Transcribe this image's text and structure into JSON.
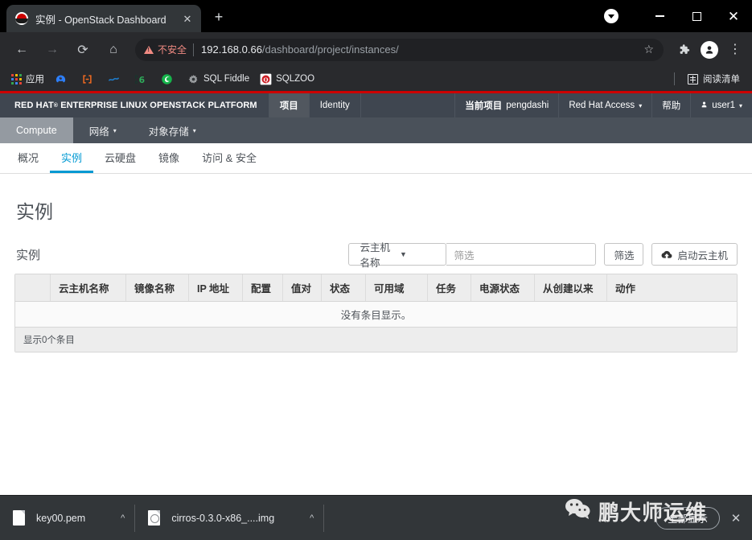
{
  "browser": {
    "tab": {
      "title": "实例 - OpenStack Dashboard",
      "favicon": "redhat-logo-icon",
      "close": "✕"
    },
    "new_tab": "+",
    "window_controls": {
      "tab_search": "tab-search-icon",
      "minimize": "minimize-icon",
      "maximize": "maximize-icon",
      "close": "✕"
    },
    "toolbar": {
      "back": "←",
      "forward": "→",
      "reload": "⟳",
      "home": "⌂",
      "security_label": "不安全",
      "url_host": "192.168.0.66",
      "url_path": "/dashboard/project/instances/",
      "bookmark_star": "☆",
      "extensions": "puzzle-piece-icon",
      "profile": "profile-avatar-icon",
      "menu": "⋮"
    },
    "bookmarks": [
      {
        "label": "应用",
        "icon": "apps-grid-icon"
      },
      {
        "label": "",
        "icon": "blue-controller-icon"
      },
      {
        "label": "",
        "icon": "orange-bracket-icon"
      },
      {
        "label": "",
        "icon": "blue-wave-icon"
      },
      {
        "label": "",
        "icon": "p6-green-icon"
      },
      {
        "label": "",
        "icon": "green-browser-icon"
      },
      {
        "label": "SQL Fiddle",
        "icon": "gray-gear-icon"
      },
      {
        "label": "SQLZOO",
        "icon": "red-badge-icon"
      }
    ],
    "reading_list": {
      "label": "阅读清单",
      "icon": "reading-list-icon"
    }
  },
  "openstack": {
    "brand": "RED HAT",
    "brand_sup": "®",
    "brand_rest": "ENTERPRISE LINUX OPENSTACK PLATFORM",
    "nav": [
      {
        "label": "项目",
        "active": true
      },
      {
        "label": "Identity",
        "active": false
      }
    ],
    "current_project_label": "当前项目",
    "current_project_name": "pengdashi",
    "redhat_access": "Red Hat Access",
    "help": "帮助",
    "user": "user1",
    "subnav": [
      {
        "label": "Compute",
        "active": true,
        "caret": false
      },
      {
        "label": "网络",
        "active": false,
        "caret": true
      },
      {
        "label": "对象存储",
        "active": false,
        "caret": true
      }
    ],
    "tabs": [
      {
        "label": "概况",
        "active": false
      },
      {
        "label": "实例",
        "active": true
      },
      {
        "label": "云硬盘",
        "active": false
      },
      {
        "label": "镜像",
        "active": false
      },
      {
        "label": "访问 & 安全",
        "active": false
      }
    ]
  },
  "page": {
    "title": "实例",
    "panel_title": "实例",
    "filter_select_value": "云主机名称",
    "filter_placeholder": "筛选",
    "filter_button": "筛选",
    "launch_button": "启动云主机",
    "table": {
      "columns": [
        "",
        "云主机名称",
        "镜像名称",
        "IP 地址",
        "配置",
        "值对",
        "状态",
        "可用域",
        "任务",
        "电源状态",
        "从创建以来",
        "动作"
      ],
      "rows": [],
      "empty_message": "没有条目显示。",
      "footer": "显示0个条目"
    }
  },
  "downloads": [
    {
      "name": "key00.pem",
      "icon": "file-icon",
      "menu": "^"
    },
    {
      "name": "cirros-0.3.0-x86_....img",
      "icon": "image-file-icon",
      "menu": "^"
    }
  ],
  "download_bar": {
    "show_all": "全部显示",
    "close": "✕"
  },
  "watermark": {
    "text": "鹏大师运维",
    "icon": "wechat-icon"
  },
  "colors": {
    "redhat_red": "#cc0000",
    "accent_blue": "#0099d3",
    "navbar": "#3f4650",
    "subnav": "#4a515a"
  }
}
